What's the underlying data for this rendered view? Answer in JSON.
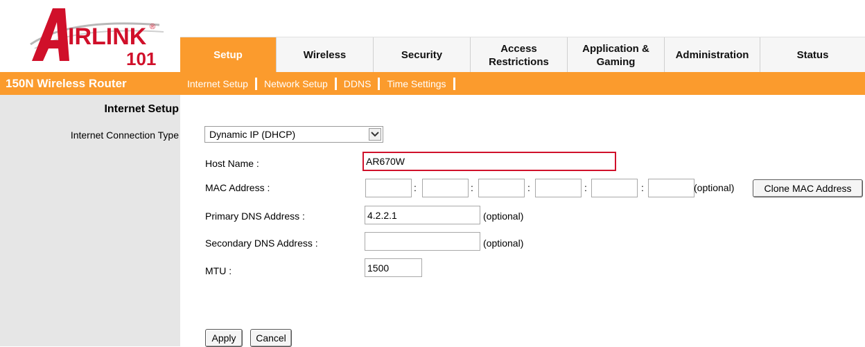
{
  "brand": {
    "logo_main": "IRLINK",
    "logo_letter": "A",
    "logo_number": "101",
    "registered": "®"
  },
  "tabs": [
    {
      "label": "Setup",
      "active": true
    },
    {
      "label": "Wireless",
      "active": false
    },
    {
      "label": "Security",
      "active": false
    },
    {
      "label": "Access\nRestrictions",
      "active": false
    },
    {
      "label": "Application &\nGaming",
      "active": false
    },
    {
      "label": "Administration",
      "active": false
    },
    {
      "label": "Status",
      "active": false
    }
  ],
  "product_name": "150N Wireless Router",
  "subnav": [
    "Internet Setup",
    "Network Setup",
    "DDNS",
    "Time Settings"
  ],
  "section_title": "Internet Setup",
  "connection": {
    "label": "Internet Connection Type",
    "selected": "Dynamic IP (DHCP)"
  },
  "form": {
    "host_name_label": "Host Name :",
    "host_name_value": "AR670W",
    "mac_label": "MAC Address :",
    "mac_values": [
      "",
      "",
      "",
      "",
      "",
      ""
    ],
    "mac_separator": ":",
    "mac_optional": "(optional)",
    "clone_mac_label": "Clone MAC Address",
    "primary_dns_label": "Primary DNS Address :",
    "primary_dns_value": "4.2.2.1",
    "primary_dns_optional": "(optional)",
    "secondary_dns_label": "Secondary DNS Address :",
    "secondary_dns_value": "",
    "secondary_dns_optional": "(optional)",
    "mtu_label": "MTU :",
    "mtu_value": "1500"
  },
  "buttons": {
    "apply": "Apply",
    "cancel": "Cancel"
  },
  "colors": {
    "accent_orange": "#fb9b2d",
    "logo_red": "#d0102a",
    "highlight_border": "#d0102a",
    "left_panel": "#e6e6e6"
  },
  "icons": [
    "airlink-logo",
    "chevron-down-icon"
  ]
}
